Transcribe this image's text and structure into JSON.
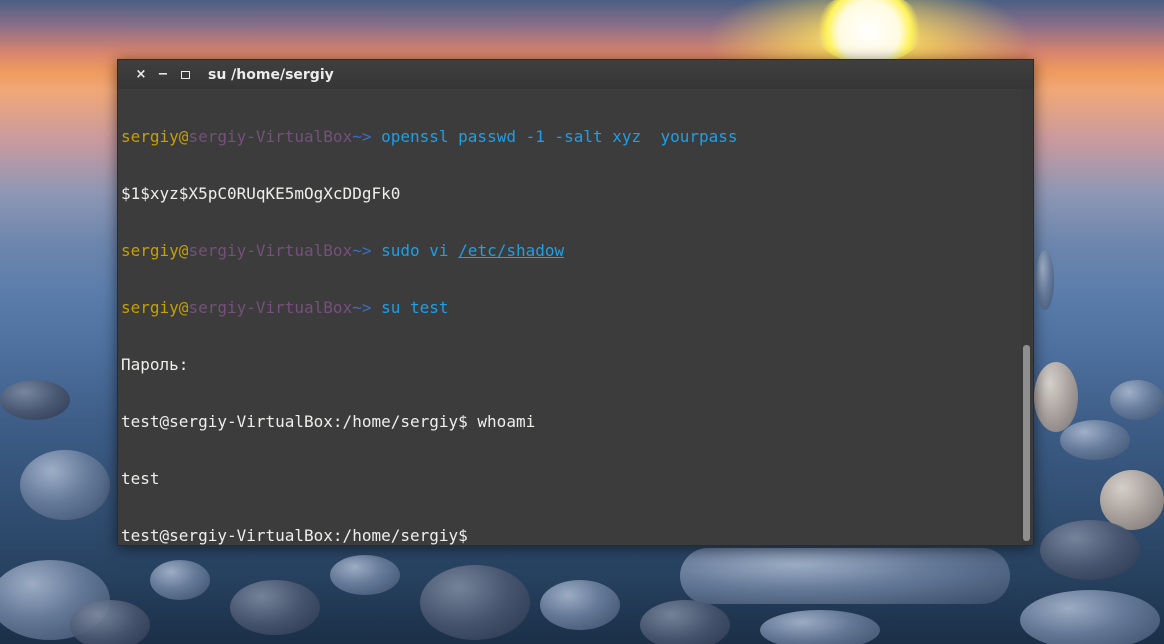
{
  "window": {
    "title": "su  /home/sergiy",
    "close_glyph": "×",
    "minimize_glyph": "−"
  },
  "terminal": {
    "lines": [
      {
        "user": "sergiy",
        "at": "@",
        "host": "sergiy-VirtualBox",
        "arrow": "~>",
        "command": " openssl passwd -1 -salt xyz  yourpass"
      },
      {
        "text": "$1$xyz$X5pC0RUqKE5mOgXcDDgFk0"
      },
      {
        "user": "sergiy",
        "at": "@",
        "host": "sergiy-VirtualBox",
        "arrow": "~>",
        "command": " sudo vi ",
        "path": "/etc/shadow"
      },
      {
        "user": "sergiy",
        "at": "@",
        "host": "sergiy-VirtualBox",
        "arrow": "~>",
        "command": " su test"
      },
      {
        "text": "Пароль:"
      },
      {
        "text": "test@sergiy-VirtualBox:/home/sergiy$ whoami"
      },
      {
        "text": "test"
      },
      {
        "text": "test@sergiy-VirtualBox:/home/sergiy$ "
      }
    ]
  },
  "colors": {
    "prompt_user": "#c4a000",
    "prompt_host": "#75507b",
    "prompt_arrow": "#3b6ec2",
    "command": "#1e9fe6",
    "text": "#eeeeec",
    "background": "#3c3c3c"
  }
}
